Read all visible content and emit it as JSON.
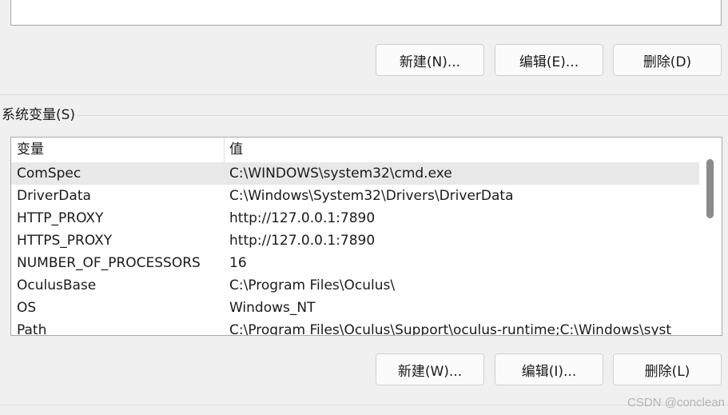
{
  "user_buttons": {
    "new": "新建(N)...",
    "edit": "编辑(E)...",
    "delete": "删除(D)"
  },
  "system_vars": {
    "group_label": "系统变量(S)",
    "columns": [
      "变量",
      "值"
    ],
    "rows": [
      {
        "name": "ComSpec",
        "value": "C:\\WINDOWS\\system32\\cmd.exe",
        "selected": true
      },
      {
        "name": "DriverData",
        "value": "C:\\Windows\\System32\\Drivers\\DriverData"
      },
      {
        "name": "HTTP_PROXY",
        "value": "http://127.0.0.1:7890"
      },
      {
        "name": "HTTPS_PROXY",
        "value": "http://127.0.0.1:7890"
      },
      {
        "name": "NUMBER_OF_PROCESSORS",
        "value": "16"
      },
      {
        "name": "OculusBase",
        "value": "C:\\Program Files\\Oculus\\"
      },
      {
        "name": "OS",
        "value": "Windows_NT"
      },
      {
        "name": "Path",
        "value": "C:\\Program Files\\Oculus\\Support\\oculus-runtime;C:\\Windows\\syst"
      }
    ],
    "buttons": {
      "new": "新建(W)...",
      "edit": "编辑(I)...",
      "delete": "删除(L)"
    }
  },
  "watermark": "CSDN @conclean"
}
